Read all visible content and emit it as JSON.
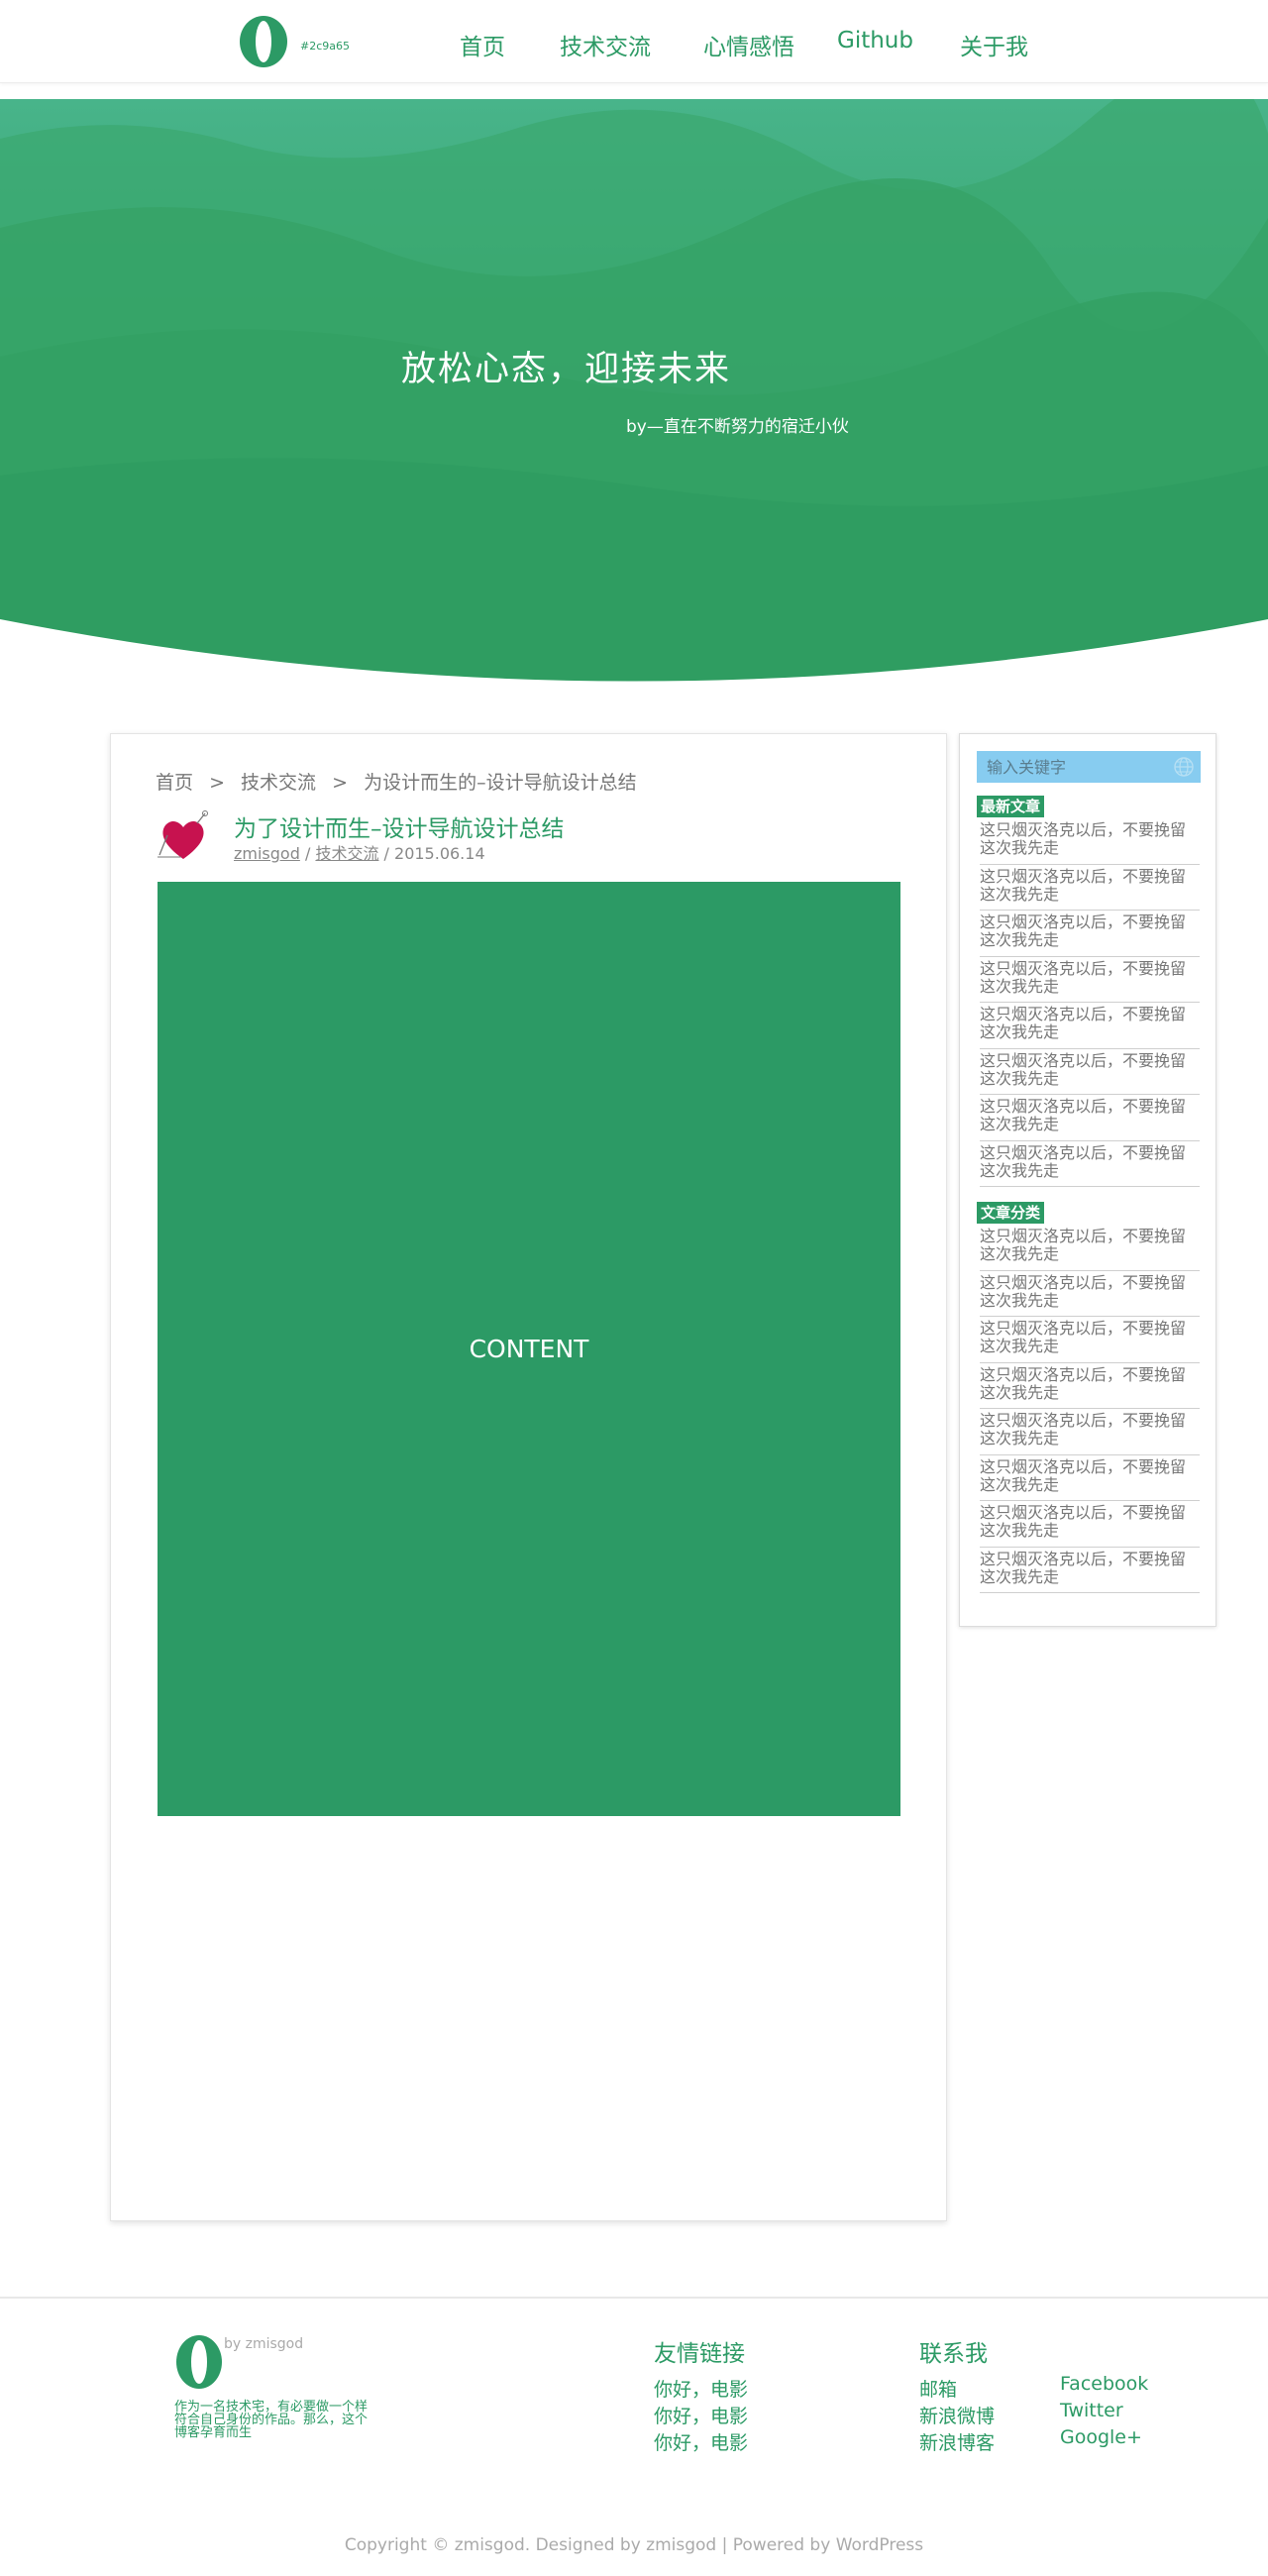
{
  "header": {
    "brand_color": "#2c9a65",
    "logo_letter": "O",
    "logo_color_label": "#2c9a65",
    "nav": [
      {
        "label": "首页"
      },
      {
        "label": "技术交流"
      },
      {
        "label": "心情感悟"
      },
      {
        "label": "Github"
      },
      {
        "label": "关于我"
      }
    ]
  },
  "hero": {
    "title": "放松心态，迎接未来",
    "subtitle": "by—直在不断努力的宿迁小伙"
  },
  "post": {
    "breadcrumb": {
      "home": "首页",
      "sep1": ">",
      "category": "技术交流",
      "sep2": ">",
      "current": "为设计而生的–设计导航设计总结"
    },
    "avatar_icon": "balloon-heart-icon",
    "title": "为了设计而生–设计导航设计总结",
    "author": "zmisgod",
    "meta_sep1": " / ",
    "category": "技术交流",
    "meta_sep2": " / ",
    "date": "2015.06.14",
    "content_label": "CONTENT"
  },
  "sidebar": {
    "search_placeholder": "输入关键字",
    "search_icon": "globe-icon",
    "latest_label": "最新文章",
    "latest": [
      "这只烟灭洛克以后，不要挽留这次我先走",
      "这只烟灭洛克以后，不要挽留这次我先走",
      "这只烟灭洛克以后，不要挽留这次我先走",
      "这只烟灭洛克以后，不要挽留这次我先走",
      "这只烟灭洛克以后，不要挽留这次我先走",
      "这只烟灭洛克以后，不要挽留这次我先走",
      "这只烟灭洛克以后，不要挽留这次我先走",
      "这只烟灭洛克以后，不要挽留这次我先走"
    ],
    "categories_label": "文章分类",
    "categories": [
      "这只烟灭洛克以后，不要挽留这次我先走",
      "这只烟灭洛克以后，不要挽留这次我先走",
      "这只烟灭洛克以后，不要挽留这次我先走",
      "这只烟灭洛克以后，不要挽留这次我先走",
      "这只烟灭洛克以后，不要挽留这次我先走",
      "这只烟灭洛克以后，不要挽留这次我先走",
      "这只烟灭洛克以后，不要挽留这次我先走",
      "这只烟灭洛克以后，不要挽留这次我先走"
    ]
  },
  "footer": {
    "logo_letter": "O",
    "by": "by zmisgod",
    "description": "作为一名技术宅，有必要做一个样符合自己身份的作品。那么，这个博客孕育而生",
    "friends_title": "友情链接",
    "friends": [
      "你好，电影",
      "你好，电影",
      "你好，电影"
    ],
    "contact_title": "联系我",
    "contact_cn": [
      "邮箱",
      "新浪微博",
      "新浪博客"
    ],
    "contact_en": [
      "Facebook",
      "Twitter",
      "Google+"
    ],
    "copyright": "Copyright © zmisgod. Designed by zmisgod | Powered by WordPress"
  }
}
